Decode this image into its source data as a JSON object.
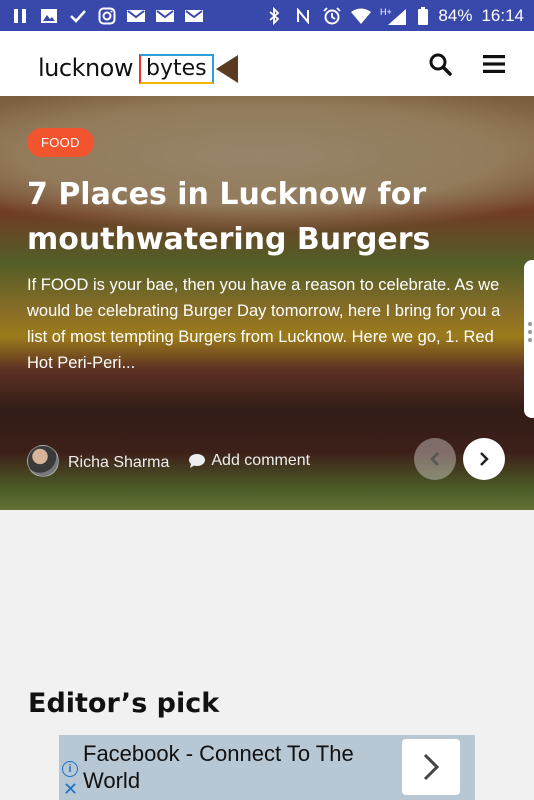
{
  "status_bar": {
    "battery": "84%",
    "time": "16:14",
    "network": "H+"
  },
  "header": {
    "logo_word1": "lucknow",
    "logo_word2": "bytes",
    "search_icon": "search-icon",
    "menu_icon": "menu-icon"
  },
  "hero": {
    "category": "FOOD",
    "title": "7 Places in Lucknow for mouthwatering Burgers",
    "excerpt": "If FOOD is your bae, then you have a reason to celebrate. As we would be celebrating Burger Day tomorrow, here I bring for you a list of most tempting Burgers from Lucknow. Here we go, 1. Red Hot Peri-Peri...",
    "author": "Richa Sharma",
    "comment_label": "Add comment"
  },
  "section": {
    "title": "Editor’s pick"
  },
  "ad": {
    "text": "Facebook - Connect To The World"
  },
  "colors": {
    "status_bar": "#3949ab",
    "category_badge": "#f2542d",
    "ad_background": "#b7c7d3"
  }
}
